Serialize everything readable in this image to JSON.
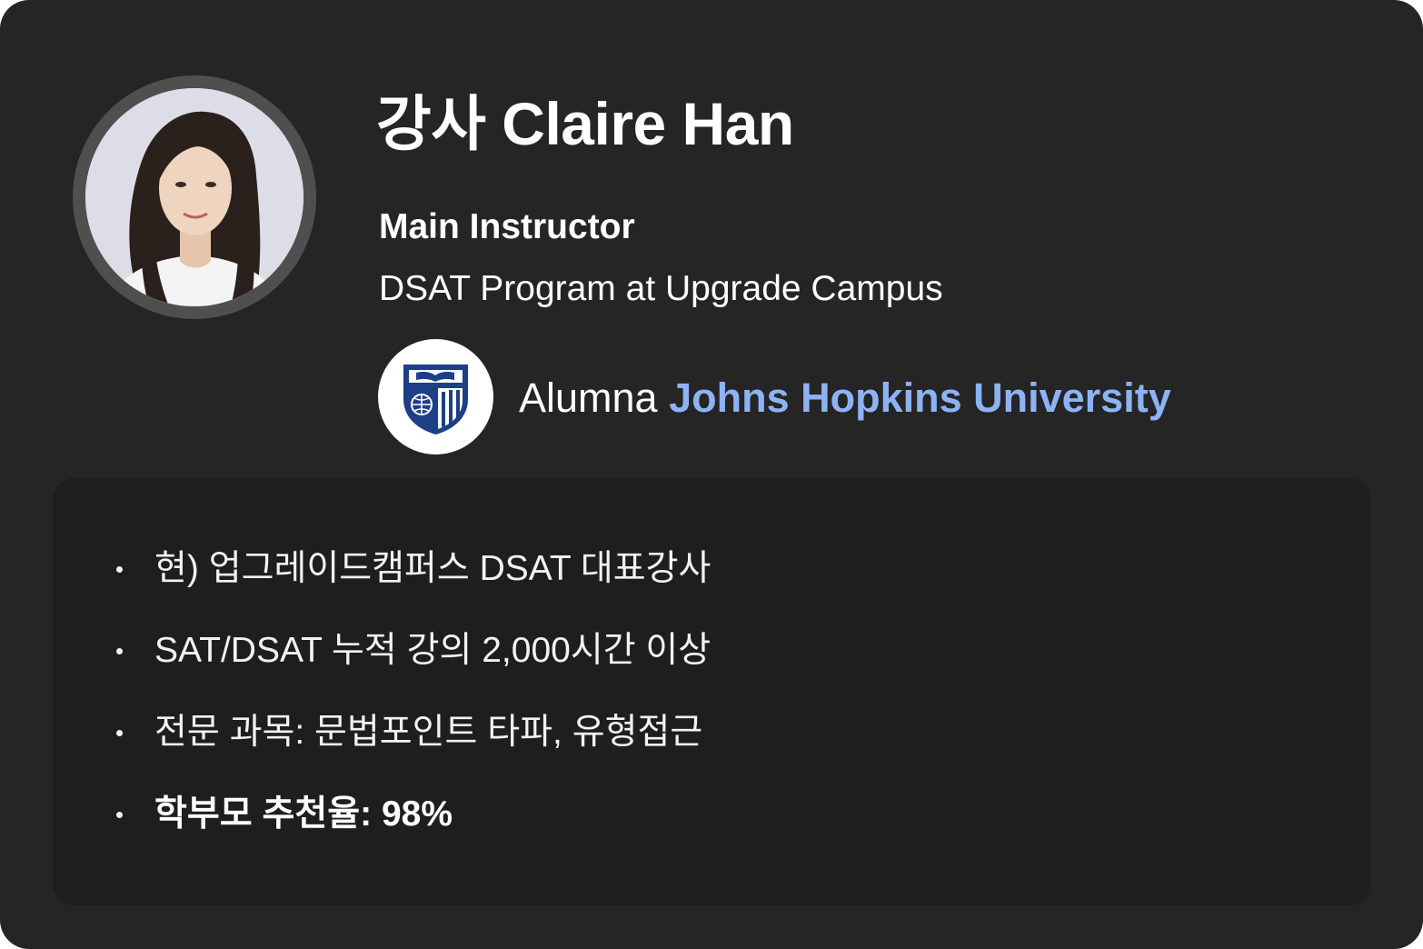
{
  "profile": {
    "name": "강사 Claire Han",
    "role": "Main Instructor",
    "program": "DSAT Program at Upgrade Campus",
    "alumna_prefix": "Alumna",
    "university": "Johns Hopkins University"
  },
  "highlights": [
    "현) 업그레이드캠퍼스 DSAT 대표강사",
    "SAT/DSAT 누적 강의 2,000시간 이상",
    "전문 과목: 문법포인트 타파, 유형접근",
    "학부모 추천율: 98%"
  ],
  "colors": {
    "card_background": "#252525",
    "panel_background": "#1e1e1e",
    "university_accent": "#8eb3f5",
    "logo_navy": "#1d3f87"
  },
  "icons": {
    "avatar": "instructor-photo",
    "logo": "university-shield-icon"
  }
}
